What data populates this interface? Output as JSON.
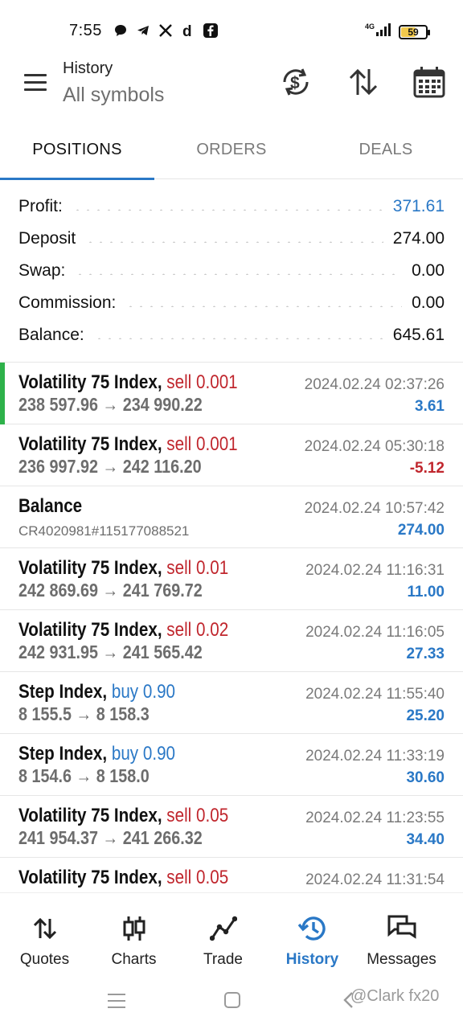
{
  "status_bar": {
    "time": "7:55",
    "notification_icons": [
      "chat-bubble-icon",
      "telegram-icon",
      "x-icon",
      "d-icon",
      "facebook-icon"
    ],
    "network": "4G",
    "battery": "59",
    "battery_color": "#f2c94c"
  },
  "header": {
    "title": "History",
    "subtitle": "All symbols",
    "icons": [
      "currency-refresh-icon",
      "sort-icon",
      "calendar-icon"
    ]
  },
  "tabs": [
    {
      "label": "POSITIONS",
      "active": true
    },
    {
      "label": "ORDERS",
      "active": false
    },
    {
      "label": "DEALS",
      "active": false
    }
  ],
  "summary": [
    {
      "label": "Profit:",
      "value": "371.61",
      "color": "#2a78c6"
    },
    {
      "label": "Deposit",
      "value": "274.00"
    },
    {
      "label": "Swap:",
      "value": "0.00"
    },
    {
      "label": "Commission:",
      "value": "0.00"
    },
    {
      "label": "Balance:",
      "value": "645.61"
    }
  ],
  "deals": [
    {
      "symbol": "Volatility 75 Index,",
      "side": "sell",
      "volume": "sell 0.001",
      "prices": "238 597.96 → 234 990.22",
      "time": "2024.02.24 02:37:26",
      "profit": "3.61",
      "selected": true
    },
    {
      "symbol": "Volatility 75 Index,",
      "side": "sell",
      "volume": "sell 0.001",
      "prices": "236 997.92 → 242 116.20",
      "time": "2024.02.24 05:30:18",
      "profit": "-5.12"
    },
    {
      "symbol": "Balance",
      "side": "",
      "volume": "",
      "comment": "CR4020981#115177088521",
      "time": "2024.02.24 10:57:42",
      "profit": "274.00"
    },
    {
      "symbol": "Volatility 75 Index,",
      "side": "sell",
      "volume": "sell 0.01",
      "prices": "242 869.69 → 241 769.72",
      "time": "2024.02.24 11:16:31",
      "profit": "11.00"
    },
    {
      "symbol": "Volatility 75 Index,",
      "side": "sell",
      "volume": "sell 0.02",
      "prices": "242 931.95 → 241 565.42",
      "time": "2024.02.24 11:16:05",
      "profit": "27.33"
    },
    {
      "symbol": "Step Index,",
      "side": "buy",
      "volume": "buy 0.90",
      "prices": "8 155.5 → 8 158.3",
      "time": "2024.02.24 11:55:40",
      "profit": "25.20"
    },
    {
      "symbol": "Step Index,",
      "side": "buy",
      "volume": "buy 0.90",
      "prices": "8 154.6 → 8 158.0",
      "time": "2024.02.24 11:33:19",
      "profit": "30.60"
    },
    {
      "symbol": "Volatility 75 Index,",
      "side": "sell",
      "volume": "sell 0.05",
      "prices": "241 954.37 → 241 266.32",
      "time": "2024.02.24 11:23:55",
      "profit": "34.40"
    },
    {
      "symbol": "Volatility 75 Index,",
      "side": "sell",
      "volume": "sell 0.05",
      "prices": "",
      "time": "2024.02.24 11:31:54",
      "profit": ""
    }
  ],
  "bottom_nav": [
    {
      "label": "Quotes",
      "icon": "quotes-icon"
    },
    {
      "label": "Charts",
      "icon": "charts-icon"
    },
    {
      "label": "Trade",
      "icon": "trade-icon"
    },
    {
      "label": "History",
      "icon": "history-icon",
      "active": true
    },
    {
      "label": "Messages",
      "icon": "messages-icon"
    }
  ],
  "watermark": "@Clark fx20",
  "colors": {
    "accent": "#2a78c6",
    "loss": "#c0262d",
    "selected_marker": "#2eb24a"
  }
}
